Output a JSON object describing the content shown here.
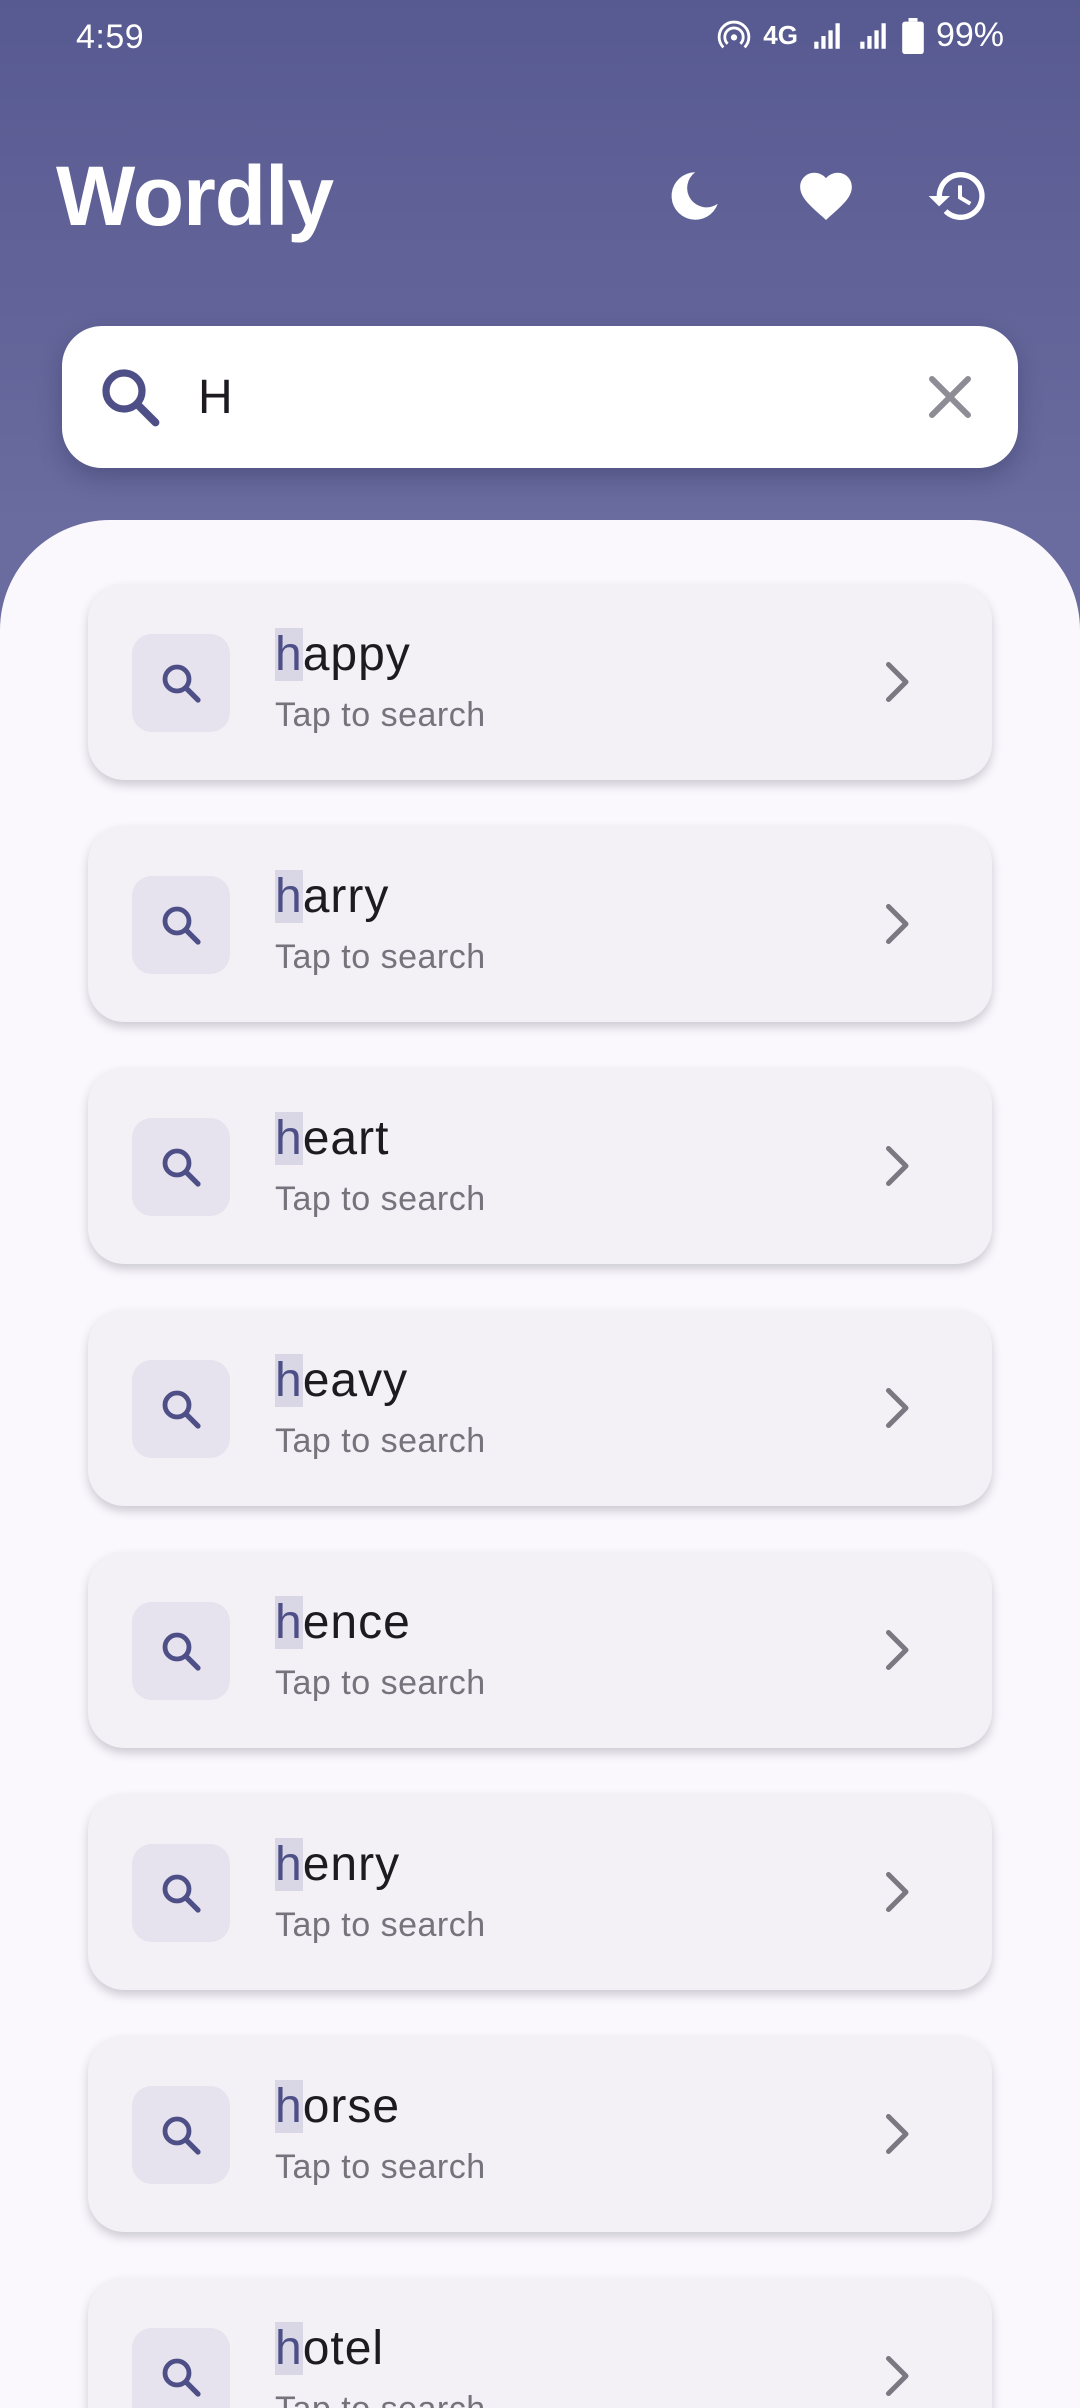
{
  "status_bar": {
    "time": "4:59",
    "network": "4G",
    "battery": "99%"
  },
  "header": {
    "title": "Wordly",
    "icons": [
      "moon-icon",
      "heart-icon",
      "history-icon"
    ]
  },
  "search": {
    "value": "H",
    "placeholder": ""
  },
  "results": [
    {
      "match": "h",
      "rest": "appy",
      "subtitle": "Tap to search"
    },
    {
      "match": "h",
      "rest": "arry",
      "subtitle": "Tap to search"
    },
    {
      "match": "h",
      "rest": "eart",
      "subtitle": "Tap to search"
    },
    {
      "match": "h",
      "rest": "eavy",
      "subtitle": "Tap to search"
    },
    {
      "match": "h",
      "rest": "ence",
      "subtitle": "Tap to search"
    },
    {
      "match": "h",
      "rest": "enry",
      "subtitle": "Tap to search"
    },
    {
      "match": "h",
      "rest": "orse",
      "subtitle": "Tap to search"
    },
    {
      "match": "h",
      "rest": "otel",
      "subtitle": "Tap to search"
    }
  ],
  "colors": {
    "primary": "#575991",
    "sheet_background": "#fbf8fd",
    "card_background": "#f3f0f6",
    "highlight": "#d9d6e6"
  }
}
